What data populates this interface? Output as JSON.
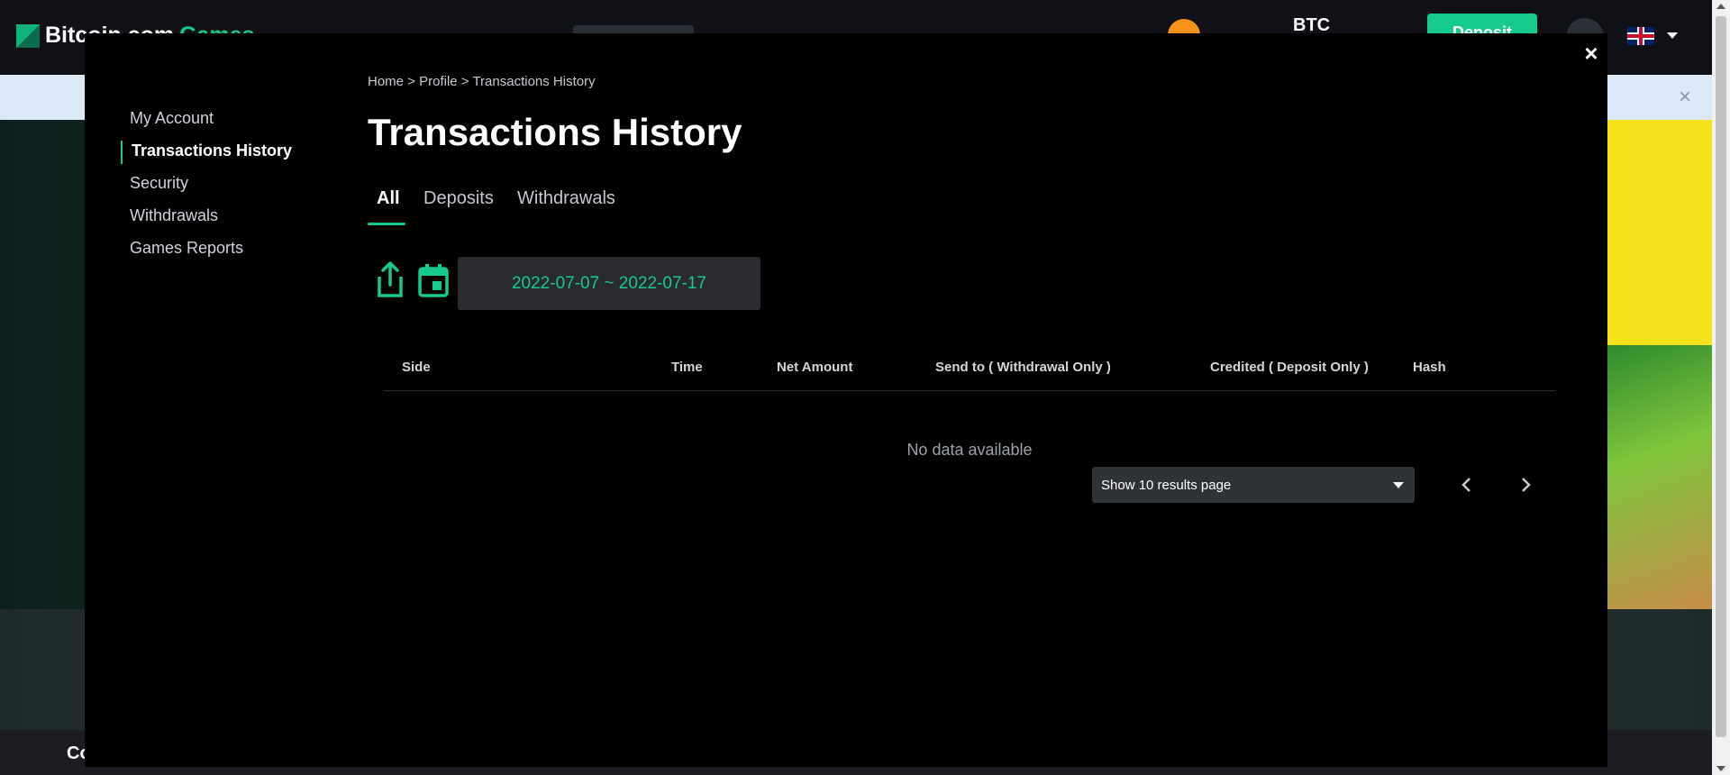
{
  "background": {
    "logo_text": "Bitcoin.com",
    "logo_games": "Games",
    "currency": "BTC",
    "deposit_label": "Deposit",
    "footer_text": "Co"
  },
  "modal": {
    "close_label": "×"
  },
  "sidebar": {
    "items": [
      {
        "label": "My Account"
      },
      {
        "label": "Transactions History"
      },
      {
        "label": "Security"
      },
      {
        "label": "Withdrawals"
      },
      {
        "label": "Games Reports"
      }
    ],
    "active_index": 1
  },
  "breadcrumb": "Home > Profile > Transactions History",
  "page_title": "Transactions History",
  "tabs": [
    {
      "label": "All"
    },
    {
      "label": "Deposits"
    },
    {
      "label": "Withdrawals"
    }
  ],
  "active_tab": 0,
  "toolbar": {
    "export_icon": "share-icon",
    "calendar_icon": "calendar-icon",
    "date_range": "2022-07-07 ~ 2022-07-17"
  },
  "table": {
    "columns": [
      "Side",
      "Time",
      "Net Amount",
      "Send to ( Withdrawal Only )",
      "Credited ( Deposit Only )",
      "Hash"
    ],
    "rows": [],
    "empty_text": "No data available"
  },
  "pagination": {
    "page_size_label": "Show 10 results page",
    "prev_icon": "chevron-left-icon",
    "next_icon": "chevron-right-icon"
  },
  "colors": {
    "accent": "#16c98d",
    "modal_bg": "#000000"
  }
}
